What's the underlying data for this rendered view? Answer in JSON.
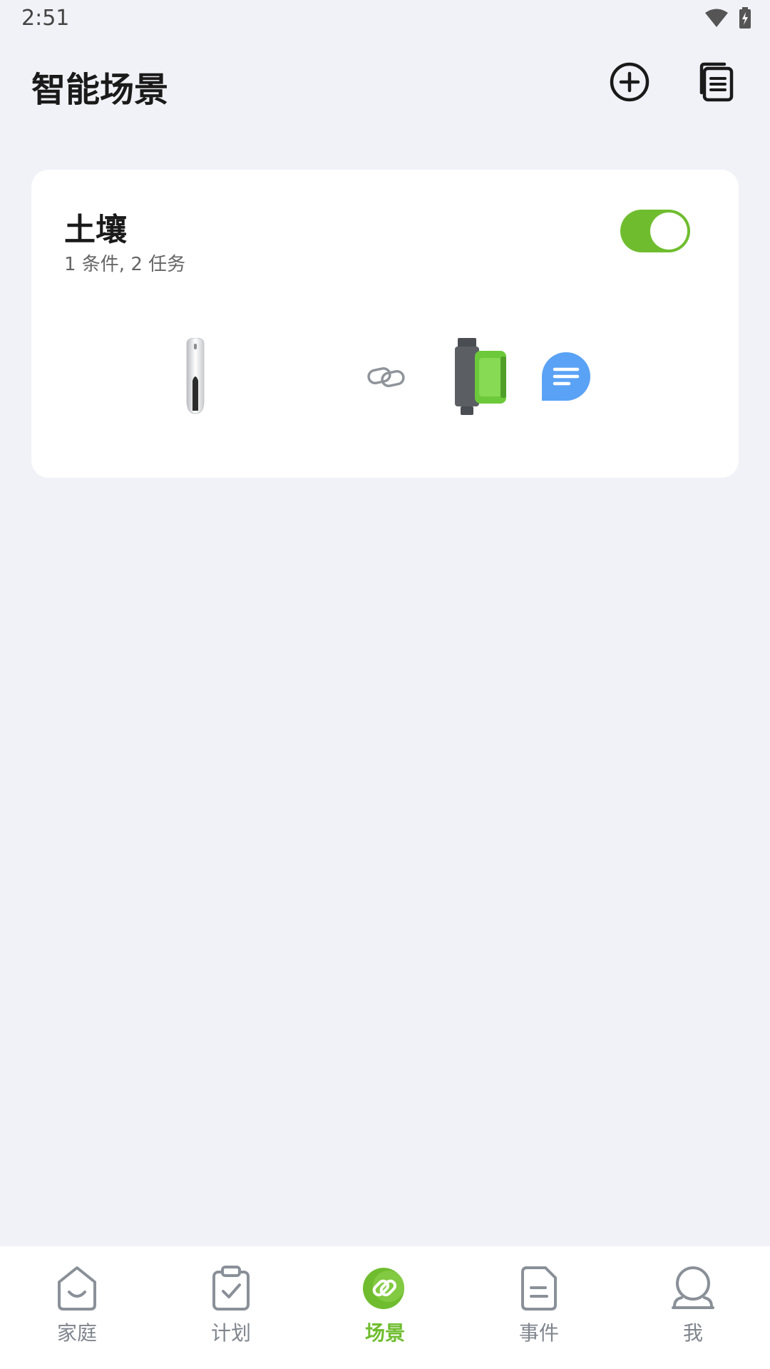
{
  "status_bar": {
    "time": "2:51",
    "wifi_icon": "wifi-icon",
    "battery_icon": "battery-charging-icon"
  },
  "header": {
    "title": "智能场景",
    "add_icon": "add-circle-icon",
    "list_icon": "document-list-icon"
  },
  "scene": {
    "name": "土壤",
    "summary": "1 条件, 2 任务",
    "enabled": true,
    "condition_device_icon": "soil-sensor-icon",
    "link_icon": "link-icon",
    "task_devices": [
      "water-valve-icon",
      "message-icon"
    ]
  },
  "bottom_nav": {
    "items": [
      {
        "label": "家庭",
        "icon": "home-icon",
        "active": false
      },
      {
        "label": "计划",
        "icon": "clipboard-check-icon",
        "active": false
      },
      {
        "label": "场景",
        "icon": "scene-link-icon",
        "active": true
      },
      {
        "label": "事件",
        "icon": "document-icon",
        "active": false
      },
      {
        "label": "我",
        "icon": "profile-icon",
        "active": false
      }
    ]
  },
  "colors": {
    "accent": "#6fbd2f",
    "background": "#f0f2f7",
    "card": "#ffffff",
    "message_blue": "#5aa2f5"
  }
}
